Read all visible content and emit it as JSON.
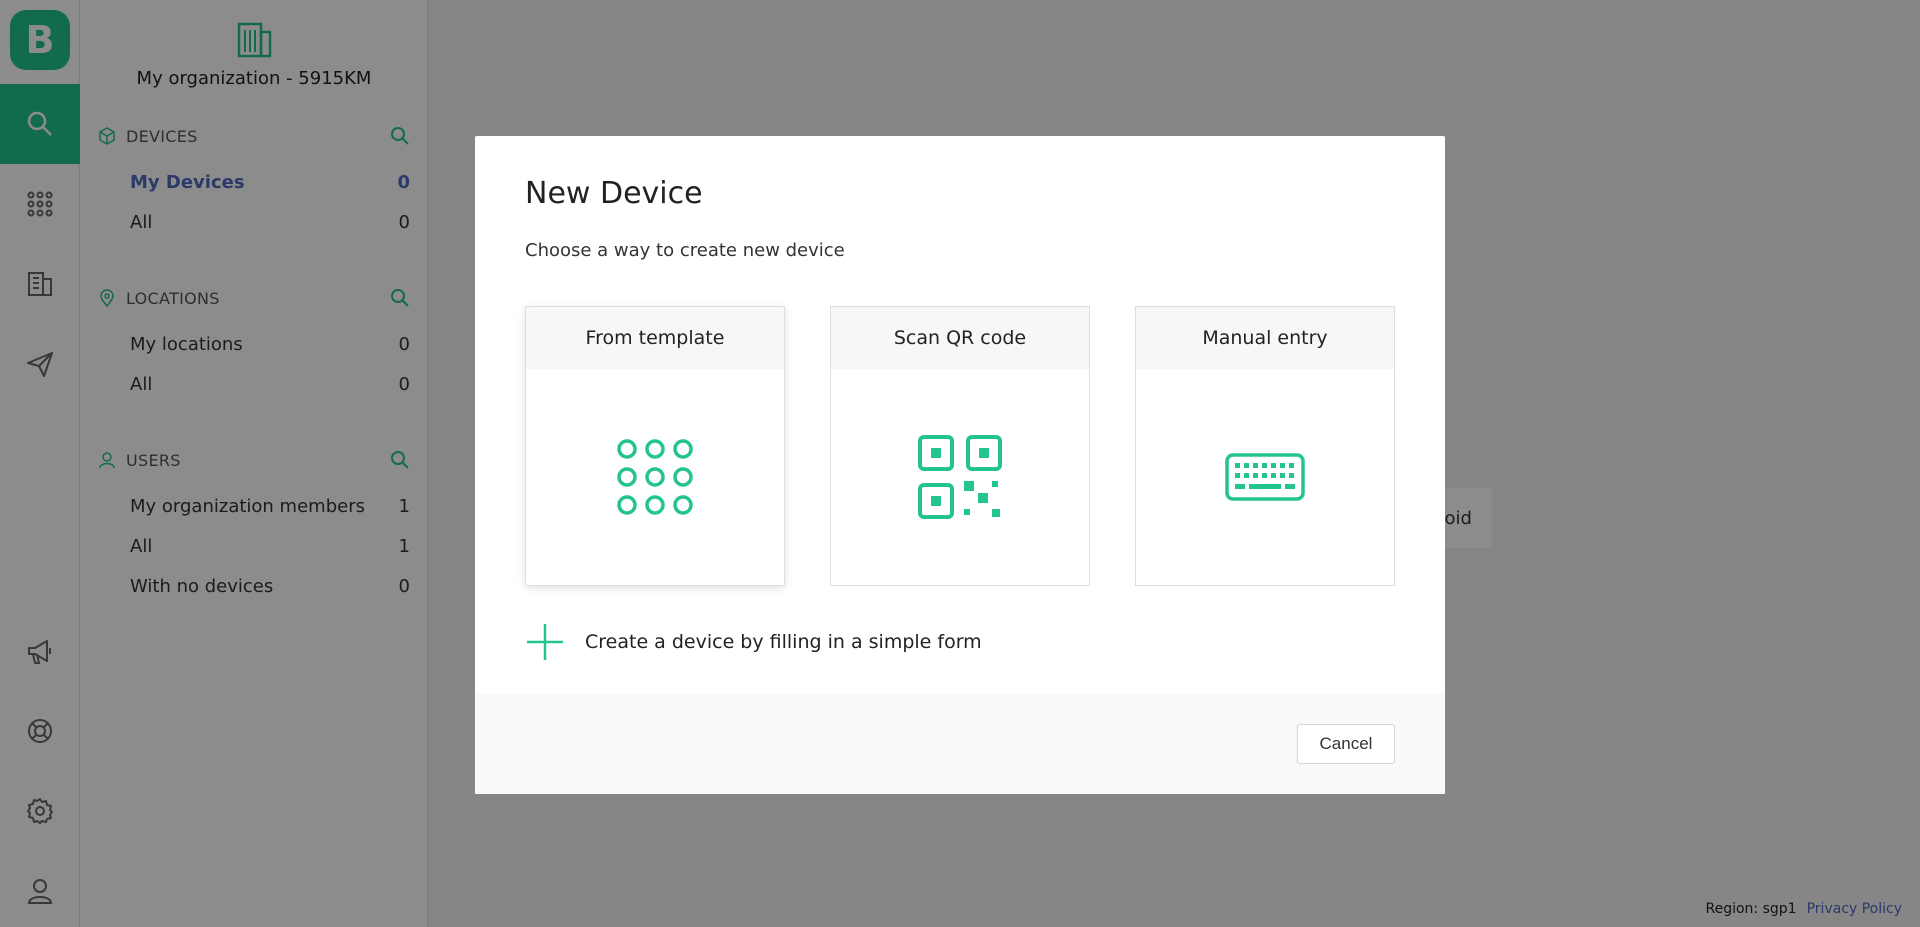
{
  "colors": {
    "accent": "#23c48e",
    "link": "#4f6bbd"
  },
  "rail": {
    "logo_letter": "B",
    "items": [
      {
        "icon": "search-icon"
      },
      {
        "icon": "grid-icon"
      },
      {
        "icon": "organization-icon"
      },
      {
        "icon": "send-icon"
      },
      {
        "icon": "megaphone-icon"
      },
      {
        "icon": "help-icon"
      },
      {
        "icon": "gear-icon"
      },
      {
        "icon": "user-icon"
      }
    ]
  },
  "sidebar": {
    "org_name": "My organization - 5915KM",
    "devices": {
      "title": "DEVICES",
      "items": [
        {
          "label": "My Devices",
          "count": "0"
        },
        {
          "label": "All",
          "count": "0"
        }
      ]
    },
    "locations": {
      "title": "LOCATIONS",
      "items": [
        {
          "label": "My locations",
          "count": "0"
        },
        {
          "label": "All",
          "count": "0"
        }
      ]
    },
    "users": {
      "title": "USERS",
      "items": [
        {
          "label": "My organization members",
          "count": "1"
        },
        {
          "label": "All",
          "count": "1"
        },
        {
          "label": "With no devices",
          "count": "0"
        }
      ]
    }
  },
  "background": {
    "chip_text": "oid"
  },
  "footer": {
    "region": "Region: sgp1",
    "privacy": "Privacy Policy"
  },
  "modal": {
    "title": "New Device",
    "subtitle": "Choose a way to create new device",
    "cards": [
      {
        "label": "From template",
        "icon": "template-grid-icon"
      },
      {
        "label": "Scan QR code",
        "icon": "qr-code-icon"
      },
      {
        "label": "Manual entry",
        "icon": "keyboard-icon"
      }
    ],
    "simple_form": "Create a device by filling in a simple form",
    "cancel": "Cancel"
  }
}
